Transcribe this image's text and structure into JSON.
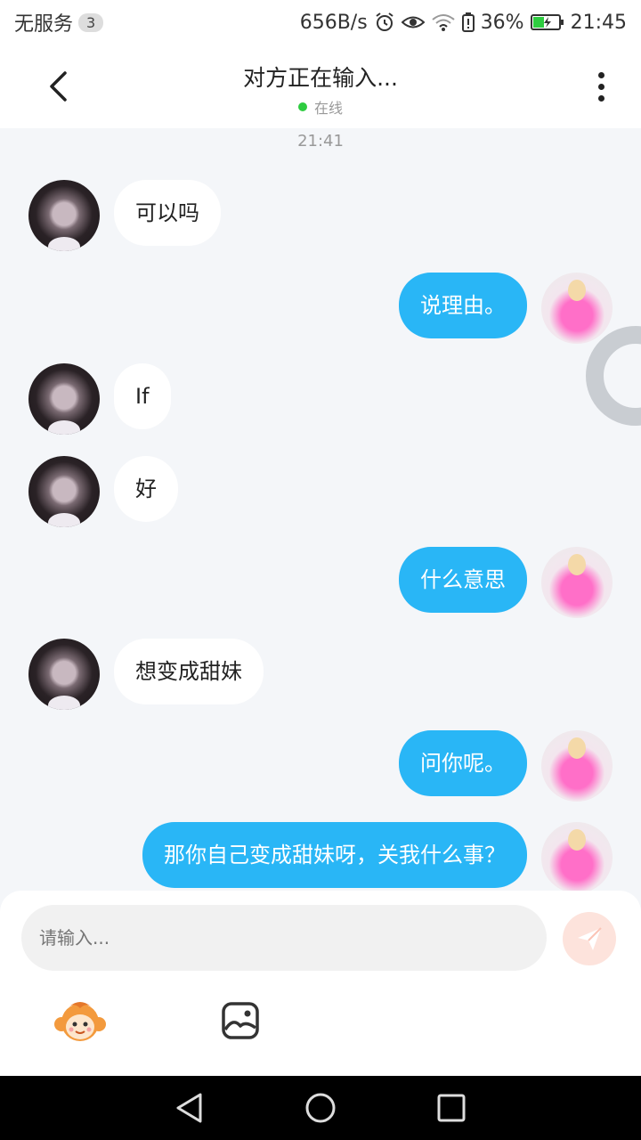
{
  "status_bar": {
    "carrier": "无服务",
    "notif_count": "3",
    "net_speed": "656B/s",
    "battery": "36%",
    "time": "21:45"
  },
  "header": {
    "title": "对方正在输入...",
    "status": "在线"
  },
  "chat": {
    "timestamp": "21:41",
    "messages": [
      {
        "side": "in",
        "text": "可以吗"
      },
      {
        "side": "out",
        "text": "说理由。"
      },
      {
        "side": "in",
        "text": "If"
      },
      {
        "side": "in",
        "text": "好"
      },
      {
        "side": "out",
        "text": "什么意思"
      },
      {
        "side": "in",
        "text": "想变成甜妹"
      },
      {
        "side": "out",
        "text": "问你呢。"
      },
      {
        "side": "out",
        "text": "那你自己变成甜妹呀，关我什么事？"
      }
    ]
  },
  "composer": {
    "placeholder": "请输入..."
  },
  "colors": {
    "outgoing_bubble": "#29b6f6",
    "incoming_bubble": "#ffffff",
    "online_dot": "#2ecc40",
    "send_button": "#fde3dc"
  },
  "icons": {
    "back": "chevron-left-icon",
    "more": "more-vertical-icon",
    "send": "paper-plane-icon",
    "emoji": "monkey-emoji-icon",
    "image": "image-icon"
  }
}
